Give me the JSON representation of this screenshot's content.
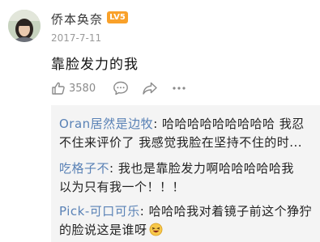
{
  "comment": {
    "username": "侨本奂奈",
    "level_badge": "LV5",
    "timestamp": "2017-7-11",
    "text": "靠脸发力的我",
    "like_count": "3580"
  },
  "actions": {
    "like_icon": "thumbs-up-icon",
    "comment_icon": "comment-icon",
    "share_icon": "share-icon",
    "more_icon": "more-icon"
  },
  "replies": [
    {
      "author": "Oran居然是边牧",
      "separator": ":",
      "text_line1": " 哈哈哈哈哈哈哈哈哈 我忍",
      "text_line2": "不住来评价了 我感觉我脸在坚持不住的时..."
    },
    {
      "author": "吃格子不",
      "separator": ":",
      "text_line1": " 我也是靠脸发力啊哈哈哈哈哈我",
      "text_line2": "以为只有我一个！！！"
    },
    {
      "author": "Pick-可口可乐",
      "separator": ":",
      "text_line1": " 哈哈哈我对着镜子前这个狰狞",
      "text_line2": "的脸说这是谁呀",
      "emoji": "laughing-face-emoji"
    }
  ],
  "colors": {
    "author_link": "#5a82b6",
    "badge": "#f9a12a",
    "reply_bg": "#f4f4f4",
    "meta_gray": "#9a9a9a"
  }
}
